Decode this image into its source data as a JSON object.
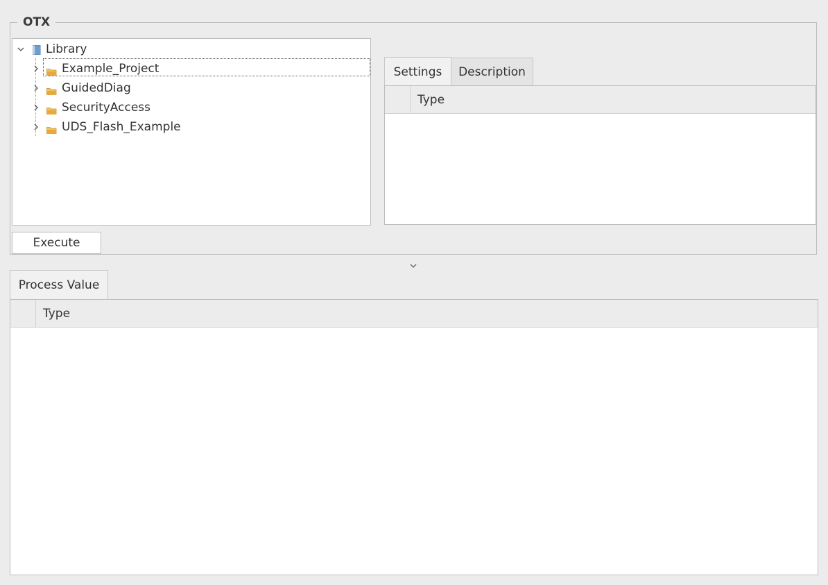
{
  "group": {
    "title": "OTX"
  },
  "tree": {
    "root": {
      "label": "Library",
      "icon": "book-icon"
    },
    "items": [
      {
        "label": "Example_Project",
        "icon": "folder-icon",
        "selected": true
      },
      {
        "label": "GuidedDiag",
        "icon": "folder-icon"
      },
      {
        "label": "SecurityAccess",
        "icon": "folder-icon"
      },
      {
        "label": "UDS_Flash_Example",
        "icon": "folder-icon"
      }
    ]
  },
  "settings_panel": {
    "tabs": [
      {
        "label": "Settings",
        "active": true
      },
      {
        "label": "Description",
        "active": false
      }
    ],
    "columns": [
      "Type"
    ]
  },
  "execute_button": {
    "label": "Execute"
  },
  "process_panel": {
    "tabs": [
      {
        "label": "Process Value",
        "active": true
      }
    ],
    "columns": [
      "Type"
    ]
  },
  "colors": {
    "background": "#ececec",
    "border": "#bcbcbc",
    "folder": "#e8a93a",
    "book": "#4a7fb8"
  }
}
